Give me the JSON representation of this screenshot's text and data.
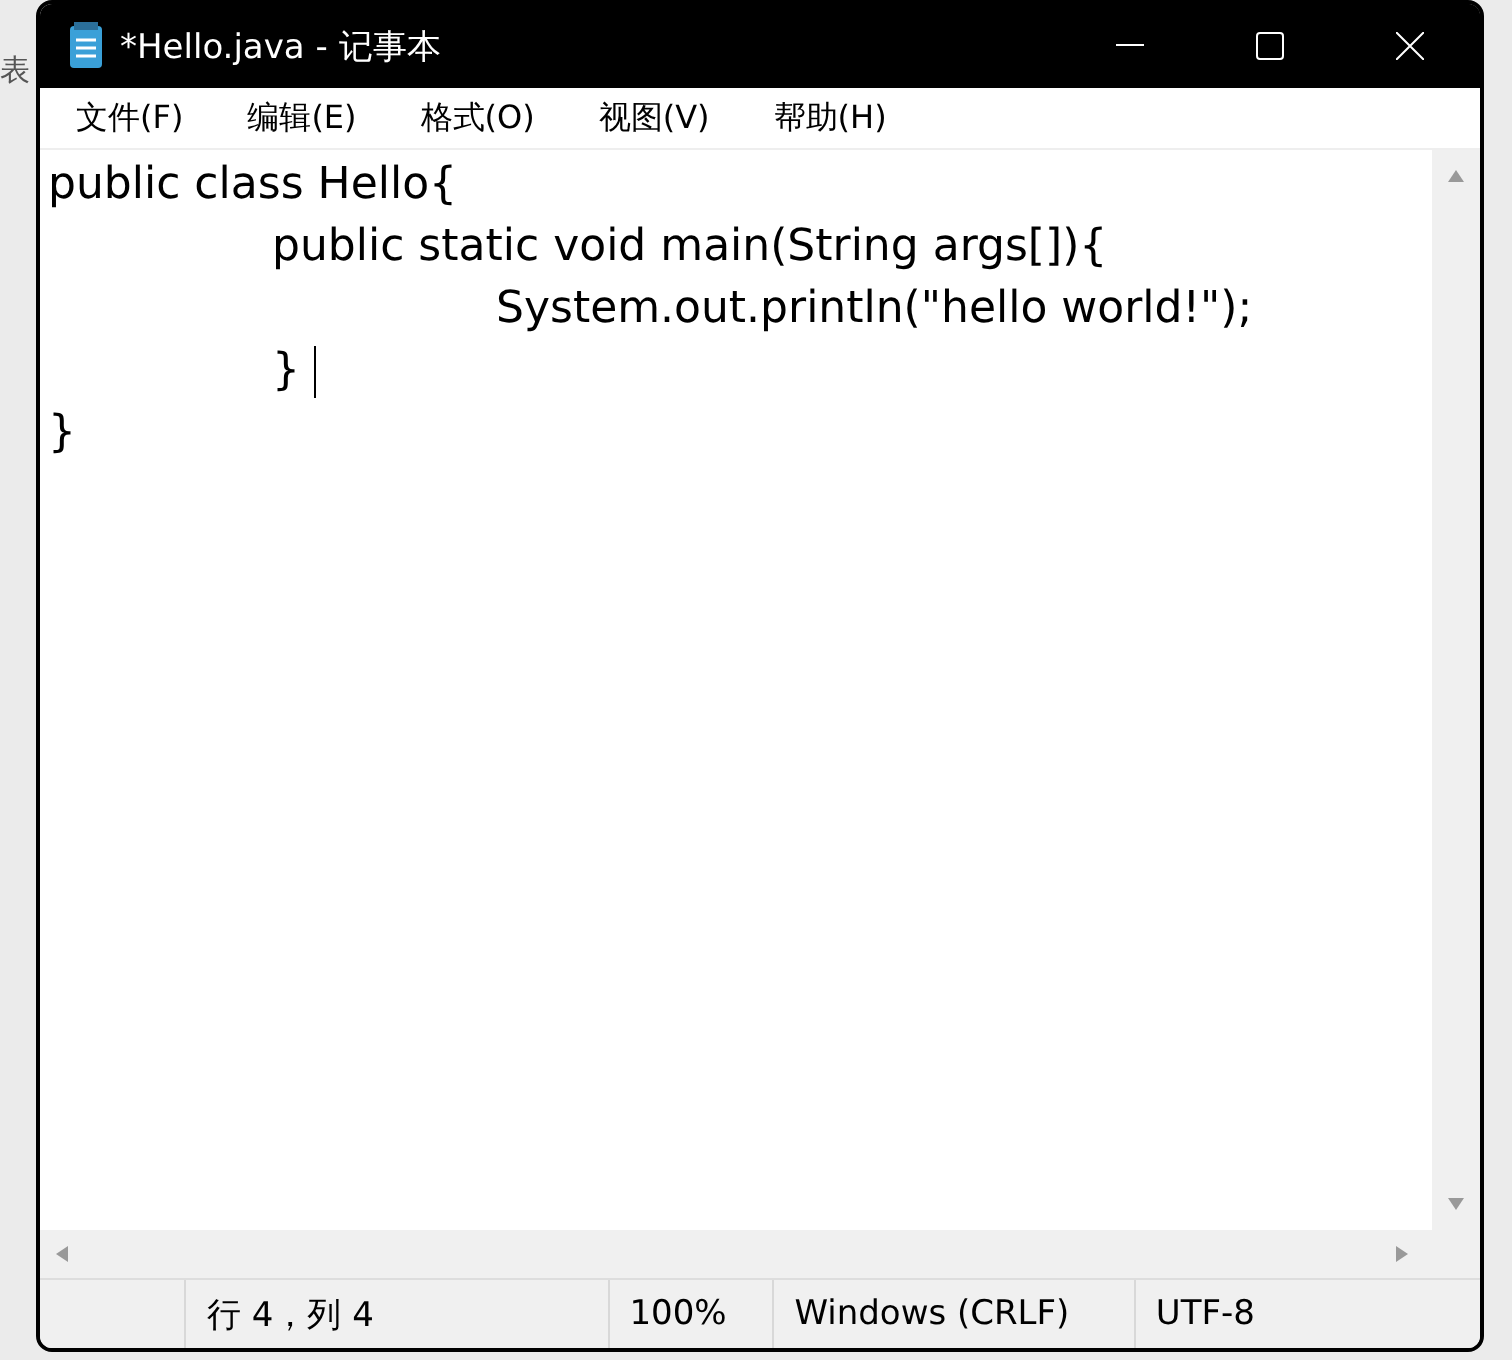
{
  "background": {
    "fragment": "表"
  },
  "window": {
    "title": "*Hello.java - 记事本"
  },
  "menu": [
    {
      "label": "文件(F)"
    },
    {
      "label": "编辑(E)"
    },
    {
      "label": "格式(O)"
    },
    {
      "label": "视图(V)"
    },
    {
      "label": "帮助(H)"
    }
  ],
  "editor": {
    "lines": [
      {
        "text": "public class Hello{",
        "caret": false
      },
      {
        "text": "\tpublic static void main(String args[]){",
        "caret": false
      },
      {
        "text": "\t\tSystem.out.println(\"hello world!\");",
        "caret": false
      },
      {
        "text": "\t} ",
        "caret": true
      },
      {
        "text": "}",
        "caret": false
      }
    ]
  },
  "status_bar": [
    "行 4，列 4",
    "100%",
    "Windows (CRLF)",
    "UTF-8"
  ]
}
